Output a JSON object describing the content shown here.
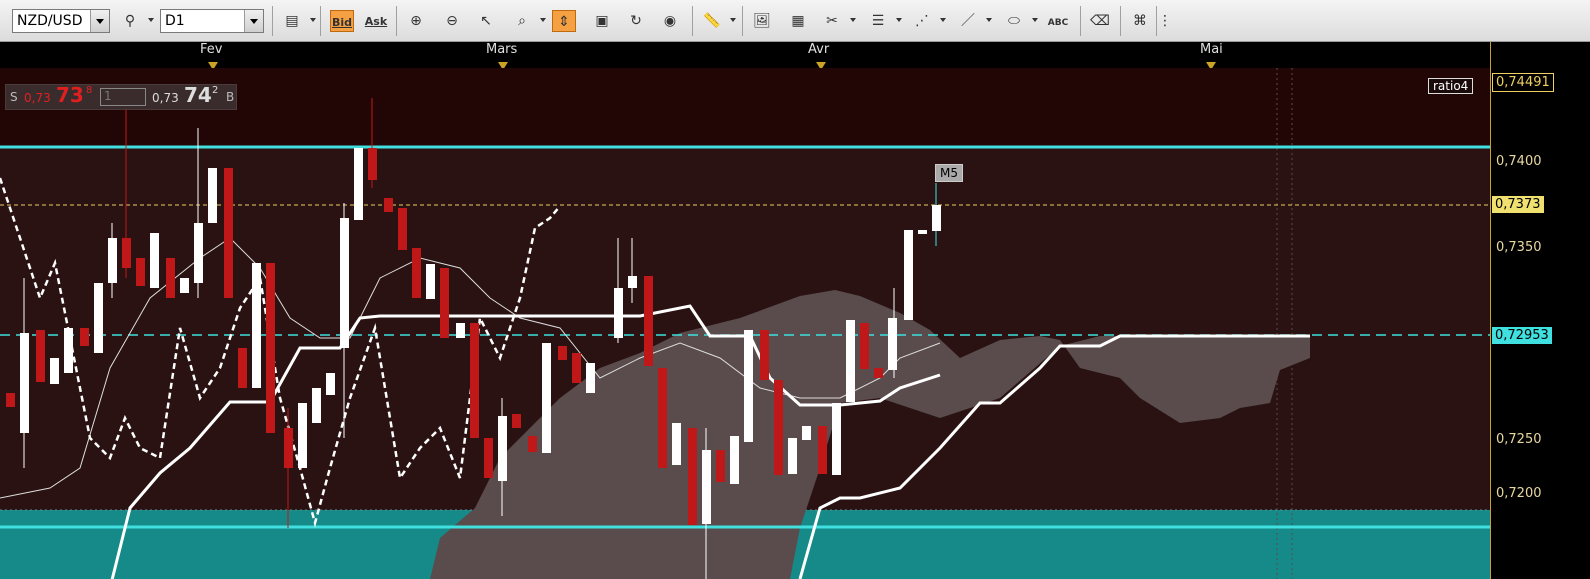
{
  "toolbar": {
    "symbol": "NZD/USD",
    "timeframe": "D1",
    "bid_label": "Bid",
    "ask_label": "Ask",
    "abc_label": "ABC"
  },
  "months": [
    "Fev",
    "Mars",
    "Avr",
    "Mai"
  ],
  "quote": {
    "sell_prefix": "S",
    "sell_small": "0,73",
    "sell_big": "73",
    "sell_sup": "8",
    "lot": "1",
    "buy_small": "0,73",
    "buy_big": "74",
    "buy_sup": "2",
    "buy_suffix": "B"
  },
  "indicator_label": "ratio4",
  "marker_label": "M5",
  "price_axis": {
    "labels": [
      "0,7400",
      "0,7350",
      "0,7250",
      "0,7200"
    ],
    "top_box": "0,74491",
    "current_box": "0,7373",
    "line_box": "0,72953"
  },
  "colors": {
    "chart_bg": "#2a1212",
    "bull": "#ffffff",
    "bear": "#c01818",
    "cyan": "#40e0e0",
    "cloud": "#5a4c4c",
    "accent": "#f6a044"
  }
}
